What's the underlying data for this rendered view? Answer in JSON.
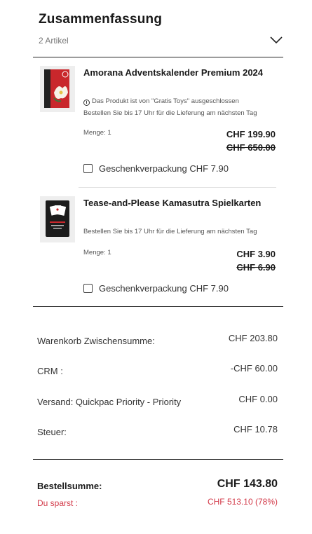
{
  "summary": {
    "title": "Zusammenfassung",
    "item_count": "2 Artikel"
  },
  "items": [
    {
      "name": "Amorana Adventskalender Premium 2024",
      "note": "Das Produkt ist von \"Gratis Toys\" ausgeschlossen",
      "delivery": "Bestellen Sie bis 17 Uhr für die Lieferung am nächsten Tag",
      "quantity": "Menge: 1",
      "price": "CHF 199.90",
      "old_price": "CHF 650.00",
      "gift_wrap": "Geschenkverpackung CHF 7.90"
    },
    {
      "name": "Tease-and-Please Kamasutra Spielkarten",
      "delivery": "Bestellen Sie bis 17 Uhr für die Lieferung am nächsten Tag",
      "quantity": "Menge: 1",
      "price": "CHF 3.90",
      "old_price": "CHF 6.90",
      "gift_wrap": "Geschenkverpackung CHF 7.90"
    }
  ],
  "totals": {
    "subtotal_label": "Warenkorb Zwischensumme:",
    "subtotal_value": "CHF 203.80",
    "crm_label": "CRM :",
    "crm_value": "-CHF 60.00",
    "shipping_label": "Versand: Quickpac Priority - Priority",
    "shipping_value": "CHF 0.00",
    "tax_label": "Steuer:",
    "tax_value": "CHF 10.78",
    "order_total_label": "Bestellsumme:",
    "order_total_value": "CHF 143.80",
    "savings_label": "Du sparst :",
    "savings_value": "CHF 513.10 (78%)"
  },
  "colors": {
    "accent_red": "#d33b4a",
    "text_dark": "#1a1a1a"
  },
  "icons": [
    "chevron-down-icon",
    "info-icon",
    "checkbox"
  ]
}
